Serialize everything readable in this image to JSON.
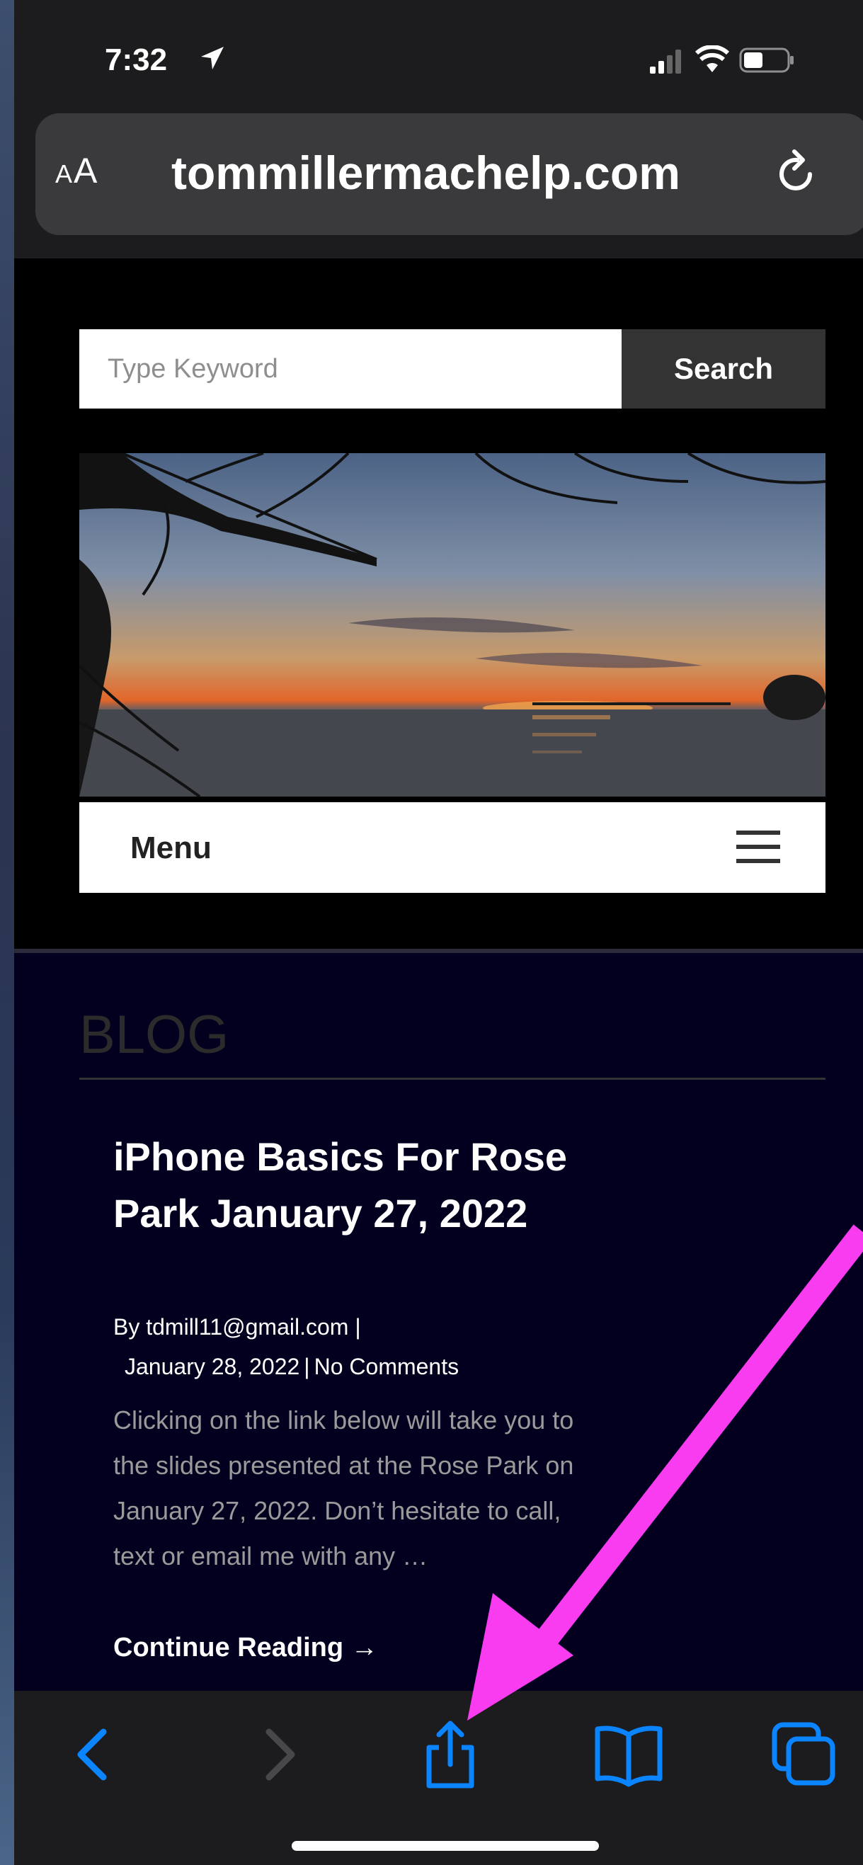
{
  "status_bar": {
    "time": "7:32",
    "icons": [
      "location-arrow-icon",
      "cellular-signal-icon",
      "wifi-icon",
      "battery-icon"
    ]
  },
  "address_bar": {
    "aa_label_small": "A",
    "aa_label_large": "A",
    "url": "tommillermachelp.com",
    "reload_icon": "reload-icon"
  },
  "search": {
    "placeholder": "Type Keyword",
    "value": "",
    "button_label": "Search"
  },
  "menu": {
    "label": "Menu",
    "icon": "hamburger-menu-icon"
  },
  "blog": {
    "heading": "BLOG",
    "post": {
      "title": "iPhone Basics For Rose Park January 27, 2022",
      "author_line": "By tdmill11@gmail.com |",
      "date": "January 28, 2022",
      "separator": "|",
      "comments": "No Comments",
      "excerpt": "Clicking on the link below will take you to the slides presented at the Rose Park on January 27, 2022. Don’t hesitate to call, text or email me with any …",
      "continue_label": "Continue Reading →"
    }
  },
  "toolbar": {
    "icons": [
      "back-chevron-icon",
      "forward-chevron-icon",
      "share-icon",
      "bookmarks-book-icon",
      "tabs-icon"
    ]
  },
  "colors": {
    "accent_blue": "#0a84ff",
    "annotation_magenta": "#f93cf0",
    "blog_background": "#03001f"
  }
}
